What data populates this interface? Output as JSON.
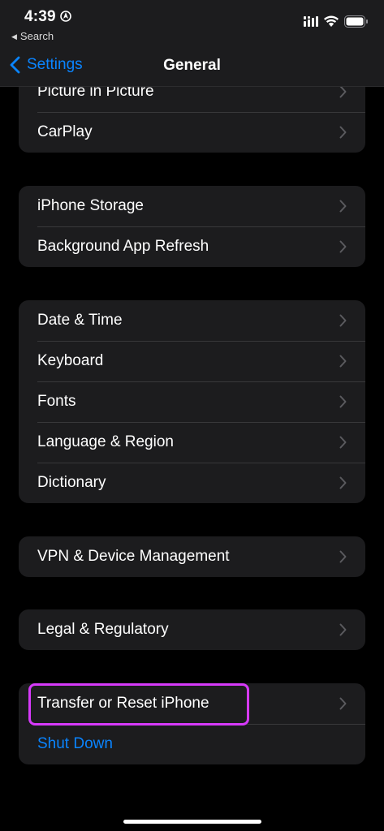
{
  "status_bar": {
    "time": "4:39",
    "back_to_app": "Search",
    "icons": [
      "location-icon",
      "cellular-signal-icon",
      "wifi-icon",
      "battery-icon"
    ]
  },
  "nav": {
    "back_label": "Settings",
    "title": "General"
  },
  "groups": [
    {
      "items": [
        "Picture in Picture",
        "CarPlay"
      ]
    },
    {
      "items": [
        "iPhone Storage",
        "Background App Refresh"
      ]
    },
    {
      "items": [
        "Date & Time",
        "Keyboard",
        "Fonts",
        "Language & Region",
        "Dictionary"
      ]
    },
    {
      "items": [
        "VPN & Device Management"
      ]
    },
    {
      "items": [
        "Legal & Regulatory"
      ]
    },
    {
      "items": [
        "Transfer or Reset iPhone"
      ],
      "action": "Shut Down"
    }
  ],
  "colors": {
    "accent": "#0a84ff",
    "highlight": "#d63af9",
    "background": "#000000",
    "cell": "#1c1c1e"
  }
}
